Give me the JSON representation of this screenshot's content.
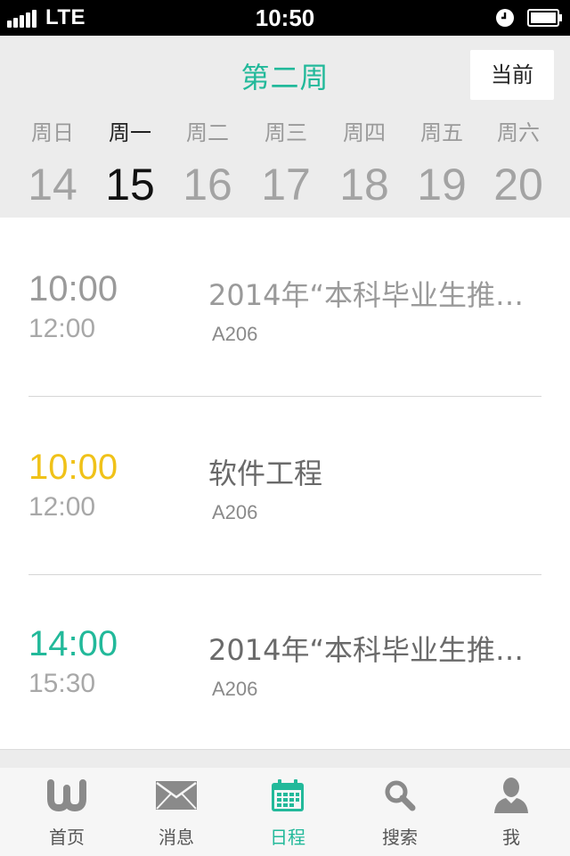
{
  "status_bar": {
    "carrier": "LTE",
    "time": "10:50"
  },
  "week": {
    "title": "第二周",
    "current_button": "当前",
    "days": [
      {
        "name": "周日",
        "date": "14"
      },
      {
        "name": "周一",
        "date": "15"
      },
      {
        "name": "周二",
        "date": "16"
      },
      {
        "name": "周三",
        "date": "17"
      },
      {
        "name": "周四",
        "date": "18"
      },
      {
        "name": "周五",
        "date": "19"
      },
      {
        "name": "周六",
        "date": "20"
      }
    ]
  },
  "events": [
    {
      "start": "10:00",
      "end": "12:00",
      "title": "2014年“本科毕业生推…",
      "room": "A206"
    },
    {
      "start": "10:00",
      "end": "12:00",
      "title": "软件工程",
      "room": "A206"
    },
    {
      "start": "14:00",
      "end": "15:30",
      "title": "2014年“本科毕业生推…",
      "room": "A206"
    }
  ],
  "tabs": [
    {
      "label": "首页",
      "icon": "home-w-icon"
    },
    {
      "label": "消息",
      "icon": "mail-icon"
    },
    {
      "label": "日程",
      "icon": "calendar-icon"
    },
    {
      "label": "搜索",
      "icon": "search-icon"
    },
    {
      "label": "我",
      "icon": "profile-icon"
    }
  ],
  "colors": {
    "accent": "#22b99a",
    "highlight": "#f0c219"
  }
}
